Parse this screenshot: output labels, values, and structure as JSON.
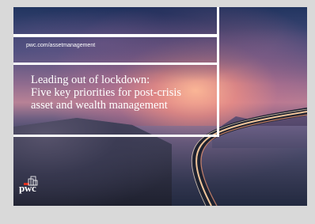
{
  "brand": {
    "url": "pwc.com/assetmanagement",
    "logo_text": "pwc"
  },
  "cover": {
    "headline_lines": [
      "Leading out of lockdown:",
      "Five key priorities for post-crisis",
      "asset and wealth management"
    ]
  },
  "colors": {
    "page_background": "#d9d9d9",
    "frame_lines": "#ffffff",
    "text": "#ffffff",
    "logo_accent": "#e0301e"
  }
}
